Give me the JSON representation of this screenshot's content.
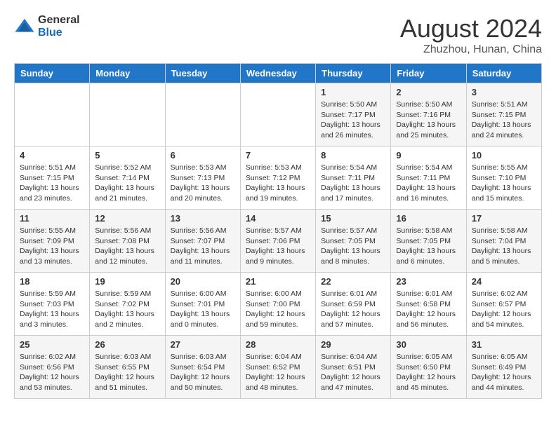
{
  "header": {
    "logo": {
      "general": "General",
      "blue": "Blue"
    },
    "title": "August 2024",
    "location": "Zhuzhou, Hunan, China"
  },
  "days_of_week": [
    "Sunday",
    "Monday",
    "Tuesday",
    "Wednesday",
    "Thursday",
    "Friday",
    "Saturday"
  ],
  "weeks": [
    [
      {
        "day": "",
        "info": ""
      },
      {
        "day": "",
        "info": ""
      },
      {
        "day": "",
        "info": ""
      },
      {
        "day": "",
        "info": ""
      },
      {
        "day": "1",
        "info": "Sunrise: 5:50 AM\nSunset: 7:17 PM\nDaylight: 13 hours\nand 26 minutes."
      },
      {
        "day": "2",
        "info": "Sunrise: 5:50 AM\nSunset: 7:16 PM\nDaylight: 13 hours\nand 25 minutes."
      },
      {
        "day": "3",
        "info": "Sunrise: 5:51 AM\nSunset: 7:15 PM\nDaylight: 13 hours\nand 24 minutes."
      }
    ],
    [
      {
        "day": "4",
        "info": "Sunrise: 5:51 AM\nSunset: 7:15 PM\nDaylight: 13 hours\nand 23 minutes."
      },
      {
        "day": "5",
        "info": "Sunrise: 5:52 AM\nSunset: 7:14 PM\nDaylight: 13 hours\nand 21 minutes."
      },
      {
        "day": "6",
        "info": "Sunrise: 5:53 AM\nSunset: 7:13 PM\nDaylight: 13 hours\nand 20 minutes."
      },
      {
        "day": "7",
        "info": "Sunrise: 5:53 AM\nSunset: 7:12 PM\nDaylight: 13 hours\nand 19 minutes."
      },
      {
        "day": "8",
        "info": "Sunrise: 5:54 AM\nSunset: 7:11 PM\nDaylight: 13 hours\nand 17 minutes."
      },
      {
        "day": "9",
        "info": "Sunrise: 5:54 AM\nSunset: 7:11 PM\nDaylight: 13 hours\nand 16 minutes."
      },
      {
        "day": "10",
        "info": "Sunrise: 5:55 AM\nSunset: 7:10 PM\nDaylight: 13 hours\nand 15 minutes."
      }
    ],
    [
      {
        "day": "11",
        "info": "Sunrise: 5:55 AM\nSunset: 7:09 PM\nDaylight: 13 hours\nand 13 minutes."
      },
      {
        "day": "12",
        "info": "Sunrise: 5:56 AM\nSunset: 7:08 PM\nDaylight: 13 hours\nand 12 minutes."
      },
      {
        "day": "13",
        "info": "Sunrise: 5:56 AM\nSunset: 7:07 PM\nDaylight: 13 hours\nand 11 minutes."
      },
      {
        "day": "14",
        "info": "Sunrise: 5:57 AM\nSunset: 7:06 PM\nDaylight: 13 hours\nand 9 minutes."
      },
      {
        "day": "15",
        "info": "Sunrise: 5:57 AM\nSunset: 7:05 PM\nDaylight: 13 hours\nand 8 minutes."
      },
      {
        "day": "16",
        "info": "Sunrise: 5:58 AM\nSunset: 7:05 PM\nDaylight: 13 hours\nand 6 minutes."
      },
      {
        "day": "17",
        "info": "Sunrise: 5:58 AM\nSunset: 7:04 PM\nDaylight: 13 hours\nand 5 minutes."
      }
    ],
    [
      {
        "day": "18",
        "info": "Sunrise: 5:59 AM\nSunset: 7:03 PM\nDaylight: 13 hours\nand 3 minutes."
      },
      {
        "day": "19",
        "info": "Sunrise: 5:59 AM\nSunset: 7:02 PM\nDaylight: 13 hours\nand 2 minutes."
      },
      {
        "day": "20",
        "info": "Sunrise: 6:00 AM\nSunset: 7:01 PM\nDaylight: 13 hours\nand 0 minutes."
      },
      {
        "day": "21",
        "info": "Sunrise: 6:00 AM\nSunset: 7:00 PM\nDaylight: 12 hours\nand 59 minutes."
      },
      {
        "day": "22",
        "info": "Sunrise: 6:01 AM\nSunset: 6:59 PM\nDaylight: 12 hours\nand 57 minutes."
      },
      {
        "day": "23",
        "info": "Sunrise: 6:01 AM\nSunset: 6:58 PM\nDaylight: 12 hours\nand 56 minutes."
      },
      {
        "day": "24",
        "info": "Sunrise: 6:02 AM\nSunset: 6:57 PM\nDaylight: 12 hours\nand 54 minutes."
      }
    ],
    [
      {
        "day": "25",
        "info": "Sunrise: 6:02 AM\nSunset: 6:56 PM\nDaylight: 12 hours\nand 53 minutes."
      },
      {
        "day": "26",
        "info": "Sunrise: 6:03 AM\nSunset: 6:55 PM\nDaylight: 12 hours\nand 51 minutes."
      },
      {
        "day": "27",
        "info": "Sunrise: 6:03 AM\nSunset: 6:54 PM\nDaylight: 12 hours\nand 50 minutes."
      },
      {
        "day": "28",
        "info": "Sunrise: 6:04 AM\nSunset: 6:52 PM\nDaylight: 12 hours\nand 48 minutes."
      },
      {
        "day": "29",
        "info": "Sunrise: 6:04 AM\nSunset: 6:51 PM\nDaylight: 12 hours\nand 47 minutes."
      },
      {
        "day": "30",
        "info": "Sunrise: 6:05 AM\nSunset: 6:50 PM\nDaylight: 12 hours\nand 45 minutes."
      },
      {
        "day": "31",
        "info": "Sunrise: 6:05 AM\nSunset: 6:49 PM\nDaylight: 12 hours\nand 44 minutes."
      }
    ]
  ]
}
